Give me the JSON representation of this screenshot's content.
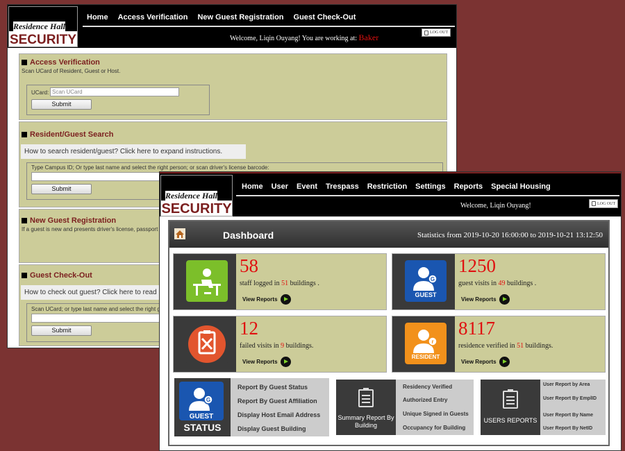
{
  "brand": {
    "line1": "Residence Hall",
    "line2": "SECURITY"
  },
  "win1": {
    "nav": [
      "Home",
      "Access Verification",
      "New Guest Registration",
      "Guest Check-Out"
    ],
    "welcome_prefix": "Welcome, Liqin Ouyang! You are working at: ",
    "location": "Baker",
    "logout": "LOG OUT",
    "access": {
      "title": "Access Verification",
      "sub": "Scan UCard of Resident, Guest or Host.",
      "ucard_label": "UCard:",
      "ucard_placeholder": "Scan UCard",
      "submit": "Submit"
    },
    "search": {
      "title": "Resident/Guest Search",
      "expand": "How to search resident/guest? Click here to expand instructions.",
      "label": "Type Campus ID; Or type last name and select the right person; or scan driver's license barcode:",
      "submit": "Submit"
    },
    "newguest": {
      "title": "New Guest Registration",
      "sub": "If a guest is new and presents driver's license, passport"
    },
    "checkout": {
      "title": "Guest Check-Out",
      "expand": "How to check out guest? Click here to read",
      "label": "Scan UCard; or type last name and select the right g",
      "submit": "Submit"
    }
  },
  "win2": {
    "nav": [
      "Home",
      "User",
      "Event",
      "Trespass",
      "Restriction",
      "Settings",
      "Reports",
      "Special Housing"
    ],
    "welcome": "Welcome, Liqin Ouyang!",
    "logout": "LOG OUT",
    "dashboard": {
      "title": "Dashboard",
      "stats": "Statistics from 2019-10-20 16:00:00 to 2019-10-21 13:12:50",
      "cards": [
        {
          "number": "58",
          "desc_pre": "staff logged in ",
          "desc_num": "51",
          "desc_post": " buildings .",
          "view": "View Reports",
          "icon": "staff-desk-icon"
        },
        {
          "number": "1250",
          "desc_pre": "guest visits in ",
          "desc_num": "49",
          "desc_post": " buildings .",
          "view": "View Reports",
          "icon": "guest-icon",
          "icon_label": "GUEST"
        },
        {
          "number": "12",
          "desc_pre": "failed visits in ",
          "desc_num": "9",
          "desc_post": " buildings.",
          "view": "View Reports",
          "icon": "failed-visit-icon"
        },
        {
          "number": "8117",
          "desc_pre": "residence verified in ",
          "desc_num": "51",
          "desc_post": " buildings.",
          "view": "View Reports",
          "icon": "resident-icon",
          "icon_label": "RESIDENT"
        }
      ],
      "guest_status": {
        "icon_label": "GUEST",
        "caption": "STATUS",
        "links": [
          "Report By Guest Status",
          "Report By Guest  Affiliation",
          "Display Host Email Address",
          "Display Guest Building"
        ]
      },
      "summary": {
        "caption": "Summary Report By Building",
        "links": [
          "Residency Verified",
          "Authorized Entry",
          "Unique Signed in Guests",
          "Occupancy for Building"
        ]
      },
      "users": {
        "caption": "USERS REPORTS",
        "links": [
          "User Report by Area",
          "User Report By EmplID",
          "User Report By Name",
          "User Report By NetID"
        ]
      }
    }
  },
  "colors": {
    "brand_maroon": "#7b1f1f",
    "panel_khaki": "#cccc99",
    "highlight_red": "#e01010"
  }
}
